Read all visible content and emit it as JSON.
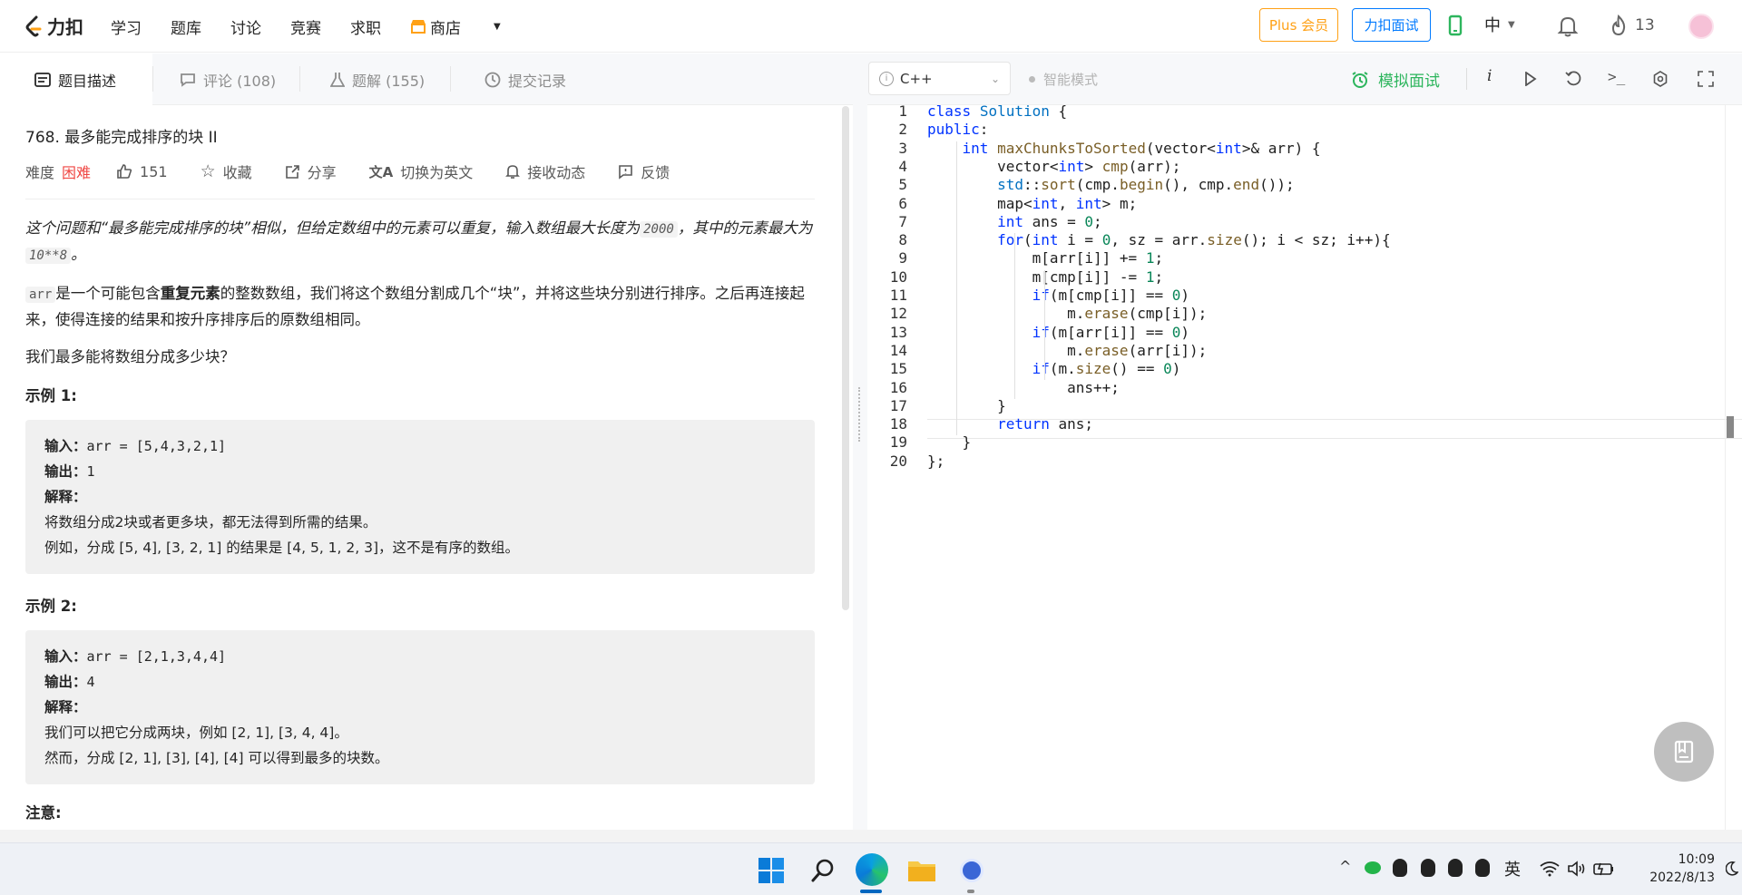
{
  "topbar": {
    "logo_text": "力扣",
    "nav": [
      "学习",
      "题库",
      "讨论",
      "竞赛",
      "求职"
    ],
    "store": "商店",
    "plus_button": "Plus 会员",
    "interview_button": "力扣面试",
    "lang": "中",
    "streak": "13",
    "brand_color": "#ffa116"
  },
  "left_tabs": {
    "description": "题目描述",
    "comments": "评论 (108)",
    "solutions": "题解 (155)",
    "submissions": "提交记录"
  },
  "problem": {
    "title": "768. 最多能完成排序的块 II",
    "difficulty_label": "难度",
    "difficulty": "困难",
    "likes": "151",
    "favorite": "收藏",
    "share": "分享",
    "switch_en": "切换为英文",
    "subscribe": "接收动态",
    "feedback": "反馈",
    "intro_a": "这个问题和“最多能完成排序的块”相似，但给定数组中的元素可以重复，输入数组最大长度为",
    "intro_code1": "2000",
    "intro_b": "，其中的元素最大为",
    "intro_code2": "10**8",
    "intro_c": "。",
    "desc_code": "arr",
    "desc_a": "是一个可能包含",
    "desc_bold": "重复元素",
    "desc_b": "的整数数组，我们将这个数组分割成几个“块”，并将这些块分别进行排序。之后再连接起来，使得连接的结果和按升序排序后的原数组相同。",
    "question": "我们最多能将数组分成多少块？",
    "example1_title": "示例 1:",
    "example1": {
      "input_label": "输入：",
      "input": "arr = [5,4,3,2,1]",
      "output_label": "输出：",
      "output": "1",
      "explain_label": "解释：",
      "line1": "将数组分成2块或者更多块，都无法得到所需的结果。",
      "line2": "例如，分成 [5, 4], [3, 2, 1] 的结果是 [4, 5, 1, 2, 3]，这不是有序的数组。"
    },
    "example2_title": "示例 2:",
    "example2": {
      "input_label": "输入：",
      "input": "arr = [2,1,3,4,4]",
      "output_label": "输出：",
      "output": "4",
      "explain_label": "解释：",
      "line1": "我们可以把它分成两块，例如 [2, 1], [3, 4, 4]。",
      "line2": "然而，分成 [2, 1], [3], [4], [4] 可以得到最多的块数。"
    },
    "note_title": "注意:"
  },
  "editor": {
    "language": "C++",
    "smart_mode": "智能模式",
    "mock_interview": "模拟面试",
    "accent": "#2db55d",
    "lines": [
      "class Solution {",
      "public:",
      "    int maxChunksToSorted(vector<int>& arr) {",
      "        vector<int> cmp(arr);",
      "        std::sort(cmp.begin(), cmp.end());",
      "        map<int, int> m;",
      "        int ans = 0;",
      "        for(int i = 0, sz = arr.size(); i < sz; i++){",
      "            m[arr[i]] += 1;",
      "            m[cmp[i]] -= 1;",
      "            if(m[cmp[i]] == 0)",
      "                m.erase(cmp[i]);",
      "            if(m[arr[i]] == 0)",
      "                m.erase(arr[i]);",
      "            if(m.size() == 0)",
      "                ans++;",
      "        }",
      "        return ans;",
      "    }",
      "};"
    ]
  },
  "taskbar": {
    "ime": "英",
    "time": "10:09",
    "date": "2022/8/13"
  }
}
